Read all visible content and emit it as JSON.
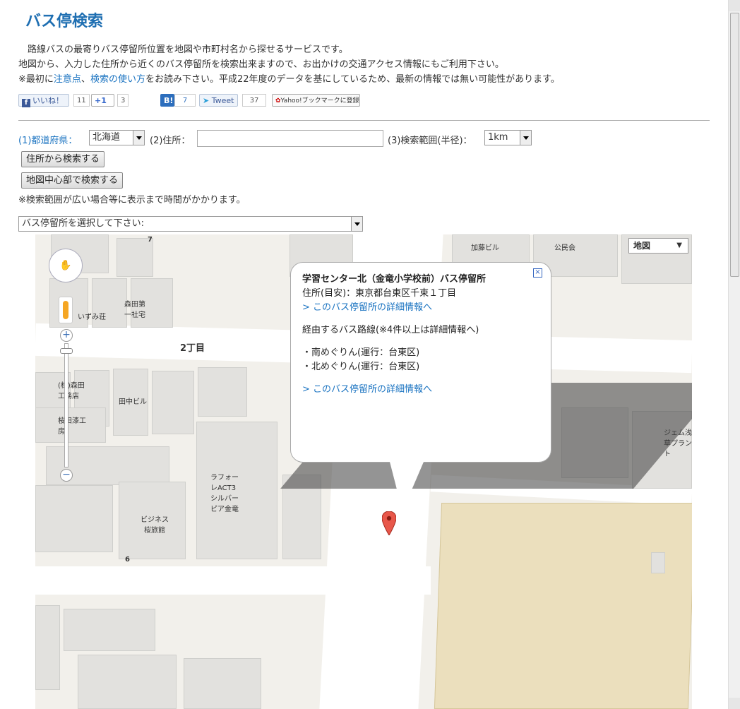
{
  "page": {
    "title": "バス停検索",
    "intro": {
      "line1": "　路線バスの最寄りバス停留所位置を地図や市町村名から探せるサービスです。",
      "line2": "地図から、入力した住所から近くのバス停留所を検索出来ますので、お出かけの交通アクセス情報にもご利用下さい。",
      "line3_prefix": "※最初に",
      "link_notes": "注意点",
      "sep": "、",
      "link_howto": "検索の使い方",
      "line3_suffix": "をお読み下さい。平成22年度のデータを基にしているため、最新の情報では無い可能性があります。"
    }
  },
  "social": {
    "like_label": "いいね！",
    "like_count": "11",
    "plusone_label": "+1",
    "plusone_count": "3",
    "hatena_label": "B!",
    "hatena_count": "7",
    "tweet_label": "Tweet",
    "tweet_count": "37",
    "yahoo_label": "Yahoo!ブックマークに登録"
  },
  "form": {
    "pref_label": "(1)都道府県：",
    "pref_value": "北海道",
    "addr_label": "(2)住所：",
    "addr_value": "",
    "range_label": "(3)検索範囲(半径)：",
    "range_value": "1km",
    "btn_addr": "住所から検索する",
    "btn_center": "地図中心部で検索する",
    "note": "※検索範囲が広い場合等に表示まで時間がかかります。",
    "stop_select": "バス停留所を選択して下さい:"
  },
  "map": {
    "type_control": "地図",
    "labels": {
      "block_2chome": "2丁目",
      "num_7": "7",
      "num_6": "6",
      "morita": "森田第一社宅",
      "izumi": "いずみ荘",
      "morita_ko": "(株)森田工務店",
      "sakura": "桜田漆工房",
      "tanaka": "田中ビル",
      "business": "ビジネス桜旅館",
      "rafore": "ラフォーレACT3シルバーピア金竜",
      "kato": "加藤ビル",
      "kominkan": "公民会",
      "gem": "ジェム浅草プラント"
    },
    "info": {
      "title": "学習センター北（金竜小学校前）バス停留所",
      "address": "住所(目安)：東京都台東区千束１丁目",
      "detail_link": "> このバス停留所の詳細情報へ",
      "routes_heading": "経由するバス路線(※4件以上は詳細情報へ)",
      "routes": [
        "・南めぐりん(運行：台東区)",
        "・北めぐりん(運行：台東区)"
      ],
      "detail_link2": "> このバス停留所の詳細情報へ"
    }
  }
}
